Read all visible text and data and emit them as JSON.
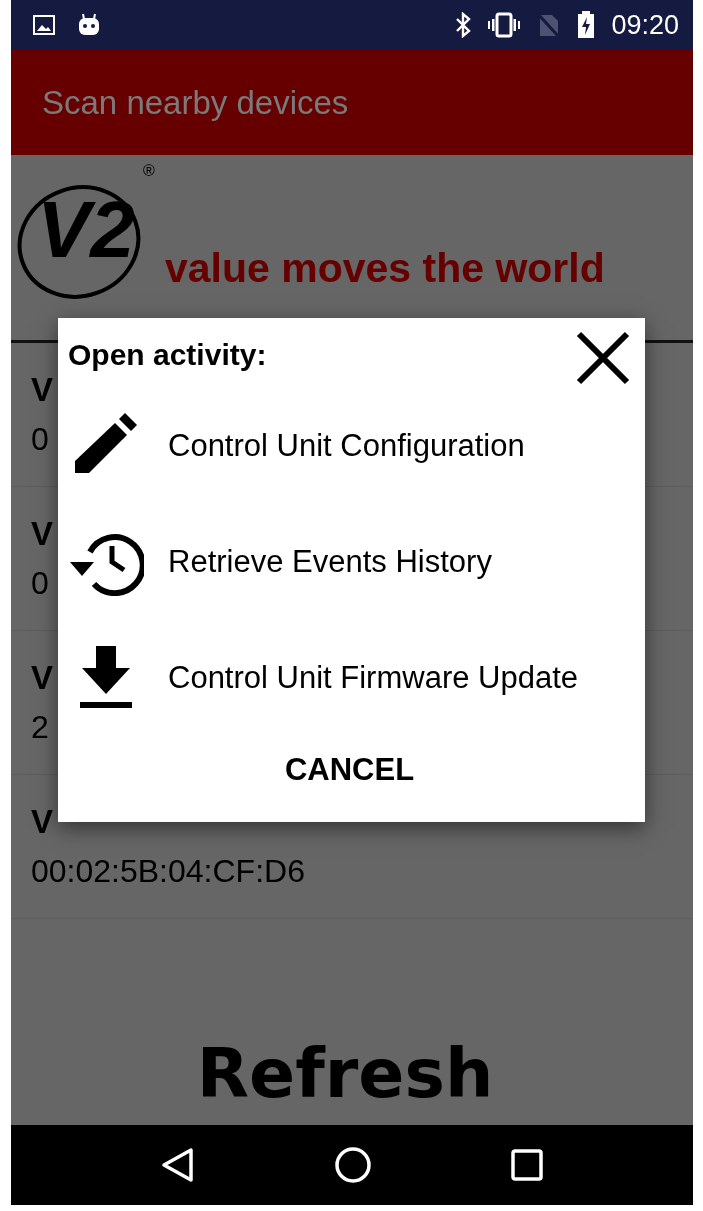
{
  "status_bar": {
    "time": "09:20"
  },
  "app_bar": {
    "title": "Scan nearby devices"
  },
  "logo": {
    "mark": "V2",
    "registered": "®",
    "tagline": "value moves the world"
  },
  "devices": [
    {
      "name": "V",
      "address": "0"
    },
    {
      "name": "V",
      "address": "0"
    },
    {
      "name": "V",
      "address": "2"
    },
    {
      "name": "V",
      "address": "00:02:5B:04:CF:D6"
    }
  ],
  "refresh_label": "Refresh",
  "dialog": {
    "title": "Open activity:",
    "items": [
      {
        "kind": "edit",
        "label": "Control Unit Configuration"
      },
      {
        "kind": "history",
        "label": "Retrieve Events History"
      },
      {
        "kind": "download",
        "label": "Control Unit Firmware Update"
      }
    ],
    "cancel": "CANCEL"
  }
}
